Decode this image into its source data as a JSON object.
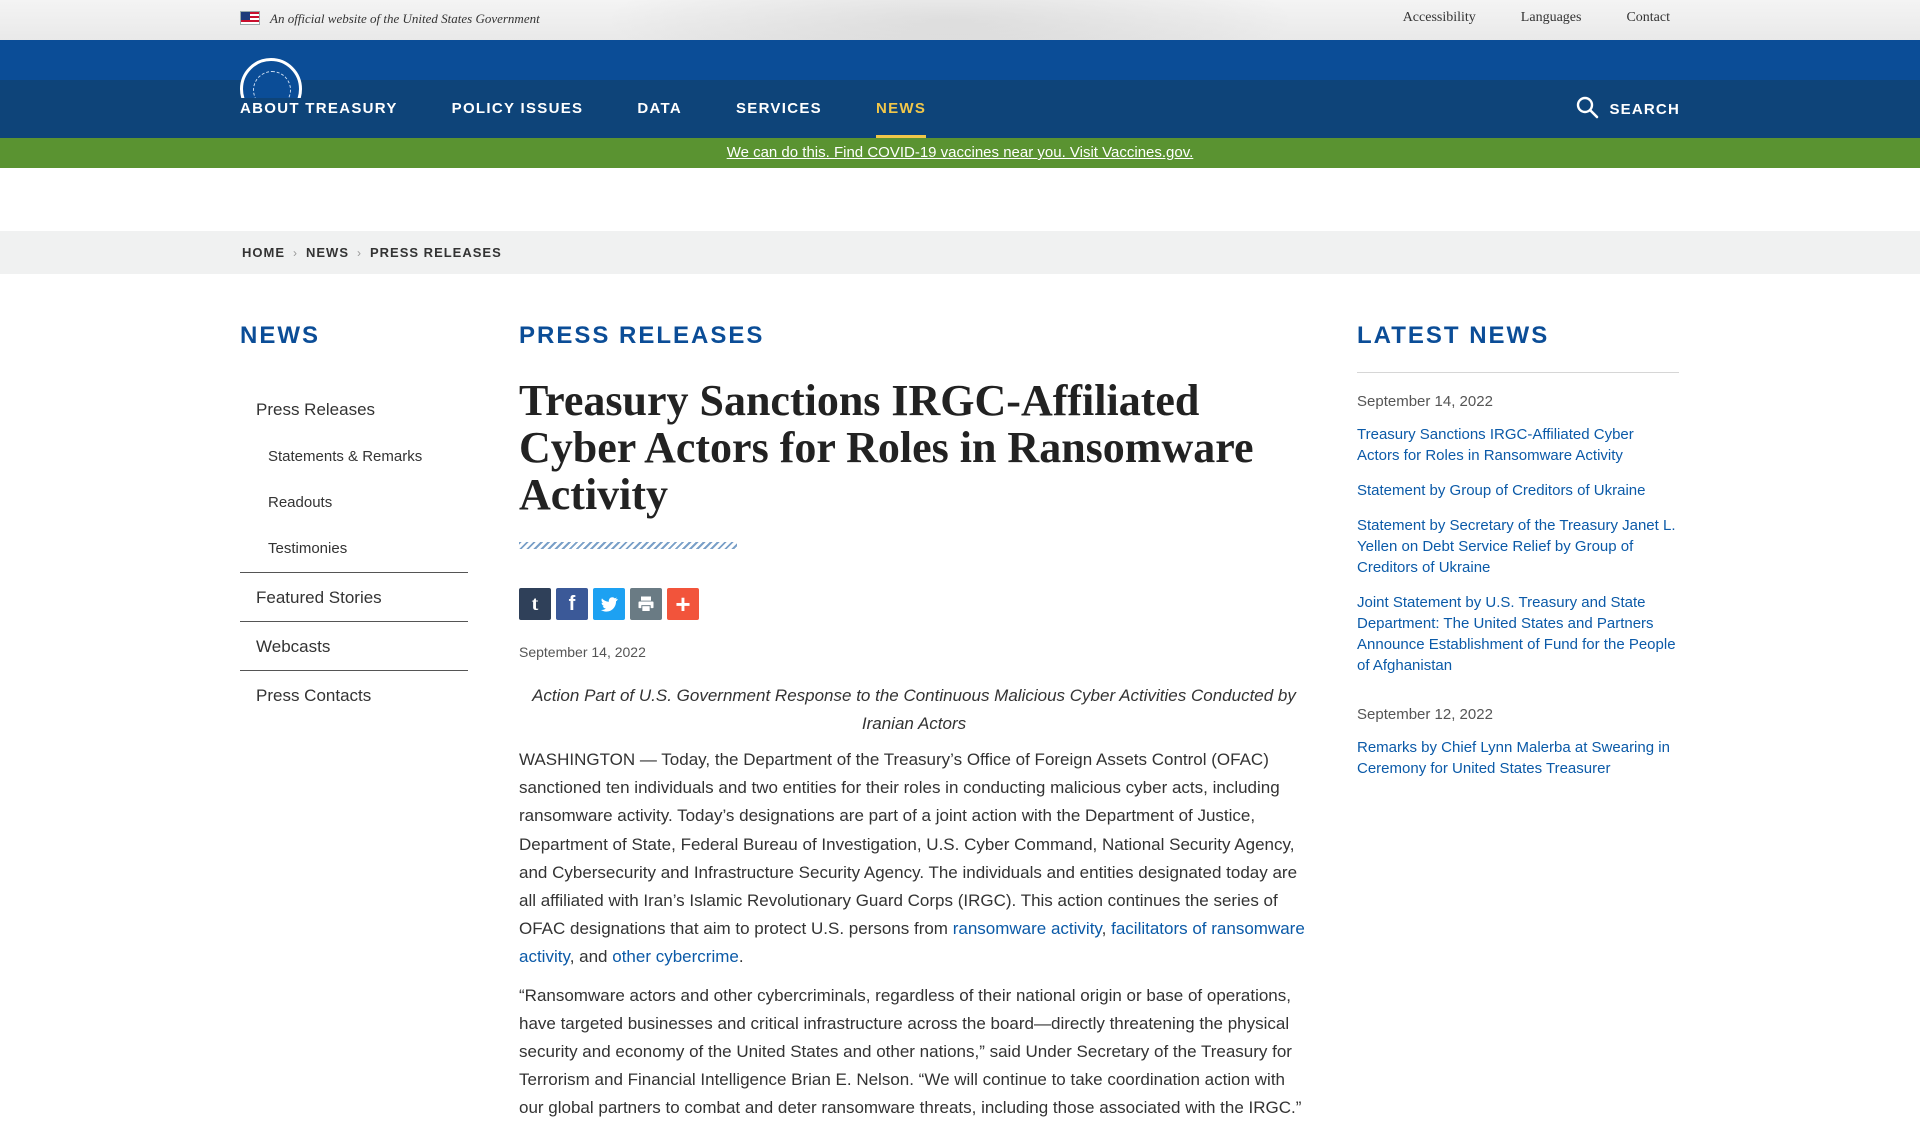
{
  "gov_banner": {
    "official_text": "An official website of the United States Government",
    "links": [
      "Accessibility",
      "Languages",
      "Contact"
    ]
  },
  "nav": {
    "items": [
      {
        "label": "ABOUT TREASURY"
      },
      {
        "label": "POLICY ISSUES"
      },
      {
        "label": "DATA"
      },
      {
        "label": "SERVICES"
      },
      {
        "label": "NEWS",
        "active": true
      }
    ],
    "search_label": "SEARCH"
  },
  "covid_banner": "We can do this. Find COVID-19 vaccines near you. Visit Vaccines.gov.",
  "breadcrumb": [
    "HOME",
    "NEWS",
    "PRESS RELEASES"
  ],
  "sidebar": {
    "title": "NEWS",
    "items": [
      {
        "label": "Press Releases"
      },
      {
        "label": "Statements & Remarks"
      },
      {
        "label": "Readouts"
      },
      {
        "label": "Testimonies"
      },
      {
        "label": "Featured Stories"
      },
      {
        "label": "Webcasts"
      },
      {
        "label": "Press Contacts"
      }
    ]
  },
  "main": {
    "section_title": "PRESS RELEASES",
    "headline": "Treasury Sanctions IRGC-Affiliated Cyber Actors for Roles in Ransomware Activity",
    "share_icons": [
      "tumblr-icon",
      "facebook-icon",
      "twitter-icon",
      "print-icon",
      "more-share-icon"
    ],
    "date": "September 14, 2022",
    "subhead": "Action Part of U.S. Government Response to the Continuous Malicious Cyber Activities Conducted by Iranian Actors",
    "para1_text": "WASHINGTON — Today, the Department of the Treasury’s Office of Foreign Assets Control (OFAC) sanctioned ten individuals and two entities for their roles in conducting malicious cyber acts, including ransomware activity. Today’s designations are part of a joint action with the Department of Justice, Department of State, Federal Bureau of Investigation, U.S. Cyber Command, National Security Agency, and Cybersecurity and Infrastructure Security Agency. The individuals and entities designated today are all affiliated with Iran’s Islamic Revolutionary Guard Corps (IRGC).  This action continues the series of OFAC designations that aim to protect U.S. persons from ",
    "para1_link1": "ransomware activity",
    "para1_sep1": ", ",
    "para1_link2": "facilitators of ransomware activity",
    "para1_sep2": ", and ",
    "para1_link3": "other cybercrime",
    "para1_end": ".",
    "para2": "“Ransomware actors and other cybercriminals, regardless of their national origin or base of operations, have targeted businesses and critical infrastructure across the board—directly threatening the physical security and economy of the United States and other nations,” said Under Secretary of the Treasury for Terrorism and Financial Intelligence Brian E. Nelson. “We will continue to take coordination action with our global partners to combat and deter ransomware threats, including those associated with the IRGC.”"
  },
  "latest": {
    "title": "LATEST NEWS",
    "groups": [
      {
        "date": "September 14, 2022",
        "items": [
          "Treasury Sanctions IRGC-Affiliated Cyber Actors for Roles in Ransomware Activity",
          "Statement by Group of Creditors of Ukraine",
          "Statement by Secretary of the Treasury Janet L. Yellen on Debt Service Relief by Group of Creditors of Ukraine",
          "Joint Statement by U.S. Treasury and State Department: The United States and Partners Announce Establishment of Fund for the People of Afghanistan"
        ]
      },
      {
        "date": "September 12, 2022",
        "items": [
          "Remarks by Chief Lynn Malerba at Swearing in Ceremony for United States Treasurer"
        ]
      }
    ]
  },
  "colors": {
    "brand_blue": "#0b4d97",
    "nav_blue": "#0e4479",
    "active_nav": "#f1c74a",
    "covid_green": "#5a9331",
    "link_blue": "#0b5aa8"
  }
}
